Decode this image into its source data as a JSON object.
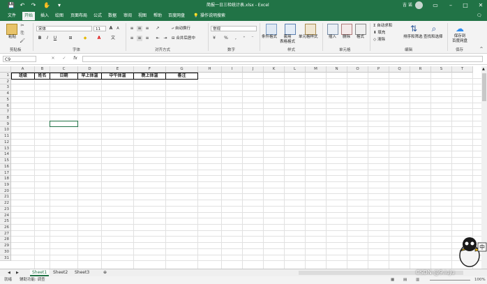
{
  "titlebar": {
    "title": "简报一日三检统计表.xlsx  -  Excel",
    "user": "吉 诺",
    "colors": {
      "brand": "#217346"
    }
  },
  "tabs": [
    "文件",
    "开始",
    "插入",
    "绘图",
    "页面布局",
    "公式",
    "数据",
    "审阅",
    "视图",
    "帮助",
    "百度网盘"
  ],
  "tell_me": "操作说明搜索",
  "ribbon": {
    "clipboard": {
      "paste": "粘贴",
      "label": "剪贴板"
    },
    "font": {
      "name": "宋体",
      "size": "11",
      "bold": "B",
      "italic": "I",
      "underline": "U",
      "grow": "A",
      "shrink": "A",
      "label": "字体"
    },
    "align": {
      "wrap": "自动换行",
      "merge": "合并后居中",
      "label": "对齐方式"
    },
    "number": {
      "format": "常规",
      "label": "数字"
    },
    "styles": {
      "cond": "条件格式",
      "table": "套用\n表格格式",
      "cell": "单元格样式",
      "label": "样式"
    },
    "cells": {
      "insert": "插入",
      "delete": "删除",
      "format": "格式",
      "label": "单元格"
    },
    "edit": {
      "autosum": "自动求和",
      "fill": "填充",
      "clear": "清除",
      "sort": "排序和筛选",
      "find": "查找和选择",
      "label": "编辑"
    },
    "save": {
      "btn": "保存到\n百度网盘",
      "label": "保存"
    }
  },
  "formula": {
    "namebox": "C9",
    "x": "✕",
    "check": "✓",
    "fx": "fx",
    "value": ""
  },
  "columns": [
    "A",
    "B",
    "C",
    "D",
    "E",
    "F",
    "G",
    "H",
    "I",
    "J",
    "K",
    "L",
    "M",
    "N",
    "O",
    "P",
    "Q",
    "R",
    "S",
    "T"
  ],
  "rows": [
    "1",
    "2",
    "3",
    "4",
    "5",
    "6",
    "7",
    "8",
    "9",
    "10",
    "11",
    "12",
    "13",
    "14",
    "15",
    "16",
    "17",
    "18",
    "19",
    "20",
    "21",
    "22",
    "23",
    "24",
    "25",
    "26",
    "27",
    "28",
    "29",
    "30",
    "31"
  ],
  "header_row": [
    "班级",
    "姓名",
    "日期",
    "早上体温",
    "中午体温",
    "晚上体温",
    "备注"
  ],
  "selected_cell": "C9",
  "sheets": [
    "Sheet1",
    "Sheet2",
    "Sheet3"
  ],
  "active_sheet": "Sheet1",
  "status": {
    "ready": "就绪",
    "accessibility": "辅助功能: 调查",
    "zoom": "100%"
  },
  "watermark": "CSDN @9.iuju"
}
